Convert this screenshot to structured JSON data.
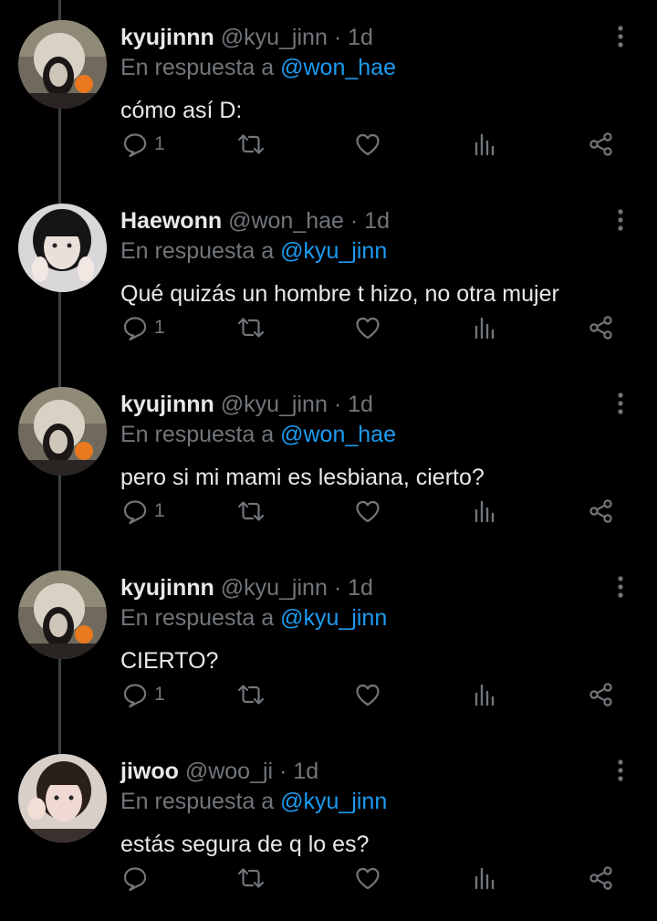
{
  "labels": {
    "reply_prefix": "En respuesta a",
    "dot": "·"
  },
  "colors": {
    "background": "#000000",
    "text": "#e7e9ea",
    "muted": "#71767b",
    "accent": "#1d9bf0",
    "thread_line": "#3e4144"
  },
  "tweets": [
    {
      "name": "kyujinnn",
      "handle": "@kyu_jinn",
      "time": "1d",
      "reply_to": "@won_hae",
      "text": "cómo así D:",
      "reply_count": "1",
      "avatar": "avatar-kyujinnn"
    },
    {
      "name": "Haewonn",
      "handle": "@won_hae",
      "time": "1d",
      "reply_to": "@kyu_jinn",
      "text": "Qué quizás un hombre t hizo, no otra mujer",
      "reply_count": "1",
      "avatar": "avatar-haewonn"
    },
    {
      "name": "kyujinnn",
      "handle": "@kyu_jinn",
      "time": "1d",
      "reply_to": "@won_hae",
      "text": "pero si mi mami es lesbiana, cierto?",
      "reply_count": "1",
      "avatar": "avatar-kyujinnn"
    },
    {
      "name": "kyujinnn",
      "handle": "@kyu_jinn",
      "time": "1d",
      "reply_to": "@kyu_jinn",
      "text": "CIERTO?",
      "reply_count": "1",
      "avatar": "avatar-kyujinnn"
    },
    {
      "name": "jiwoo",
      "handle": "@woo_ji",
      "time": "1d",
      "reply_to": "@kyu_jinn",
      "text": "estás segura de q lo es?",
      "reply_count": "",
      "avatar": "avatar-jiwoo"
    }
  ]
}
